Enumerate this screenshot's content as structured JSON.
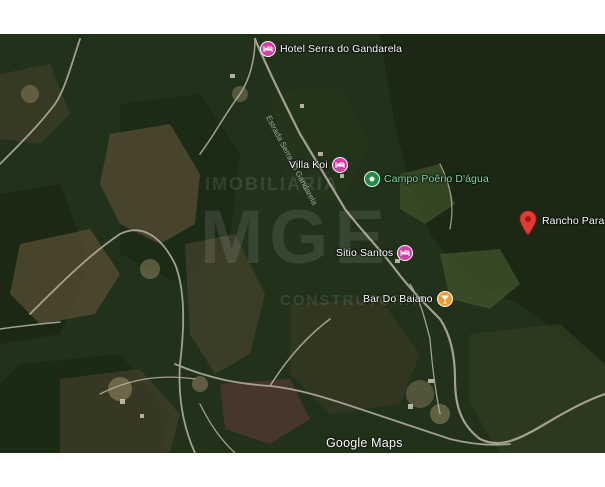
{
  "map": {
    "attribution": "Google Maps",
    "watermark_lines": [
      "IMOBILIARIA",
      "MGE",
      "CONSTRUTORA"
    ],
    "pois": [
      {
        "name": "Hotel Serra do Gandarela",
        "category": "hotel",
        "icon": "hotel-icon",
        "color": "#d63ea8",
        "label_color": "#ffffff"
      },
      {
        "name": "Villa Koi",
        "category": "hotel",
        "icon": "hotel-icon",
        "color": "#d63ea8",
        "label_color": "#ffffff"
      },
      {
        "name": "Campo Poêrio D'água",
        "category": "park",
        "icon": "park-icon",
        "color": "#1e8e3e",
        "label_color": "#7fe0a0"
      },
      {
        "name": "Sitio Santos",
        "category": "hotel",
        "icon": "hotel-icon",
        "color": "#d63ea8",
        "label_color": "#ffffff"
      },
      {
        "name": "Bar Do Baiano",
        "category": "bar",
        "icon": "cocktail-icon",
        "color": "#f29b2b",
        "label_color": "#ffffff"
      },
      {
        "name": "Rancho Para R",
        "category": "pin",
        "icon": "map-pin-icon",
        "color": "#e53935",
        "label_color": "#ffffff"
      }
    ],
    "road_labels": [
      "Estrada Serra do Gandarela"
    ]
  }
}
